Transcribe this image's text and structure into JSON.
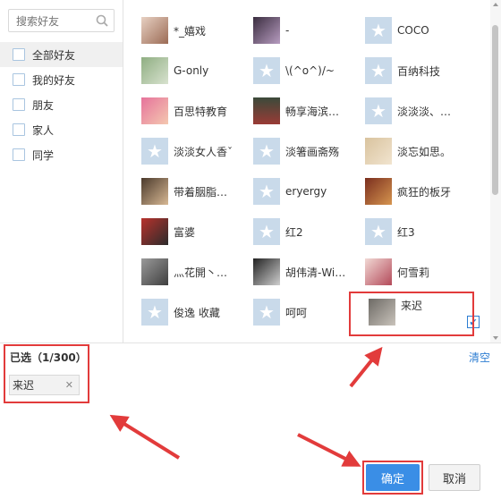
{
  "search": {
    "placeholder": "搜索好友"
  },
  "groups": [
    "全部好友",
    "我的好友",
    "朋友",
    "家人",
    "同学"
  ],
  "friends": [
    [
      "*_嬉戏",
      "-",
      "COCO"
    ],
    [
      "G-only",
      "\\(^o^)/~",
      "百纳科技"
    ],
    [
      "百思特教育",
      "畅享海滨…",
      "淡淡淡、…"
    ],
    [
      "淡淡女人香ˇ",
      "淡箸画斋殇",
      "淡忘如思。"
    ],
    [
      "带着胭脂…",
      "eryergy",
      "疯狂的板牙"
    ],
    [
      "富婆",
      "红2",
      "红3"
    ],
    [
      "灬花開丶…",
      "胡伟清-Wi…",
      "何雪莉"
    ],
    [
      "俊逸 收藏",
      "呵呵",
      "来迟"
    ]
  ],
  "selected": {
    "label": "已选（1/300）",
    "clear": "清空",
    "chips": [
      "来迟"
    ]
  },
  "buttons": {
    "ok": "确定",
    "cancel": "取消"
  },
  "colors": {
    "accent": "#3a8ee6",
    "annotation": "#e23b3b",
    "default_avatar": "#c9daea"
  }
}
